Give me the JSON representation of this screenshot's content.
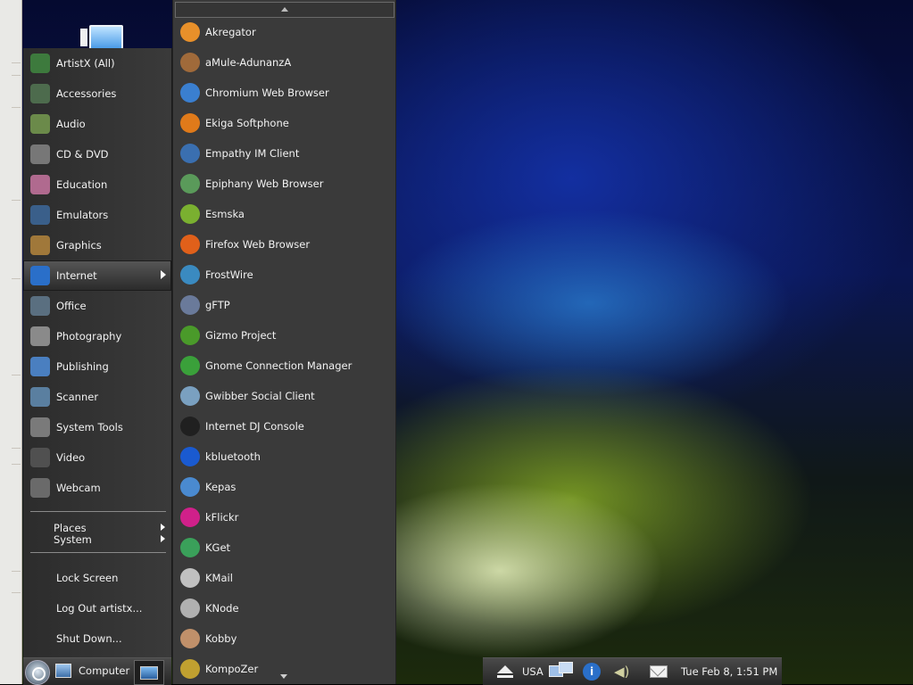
{
  "categories": [
    {
      "label": "ArtistX (All)",
      "icon": "artistx-icon",
      "color": "#3d7a3d"
    },
    {
      "label": "Accessories",
      "icon": "accessories-icon",
      "color": "#4d6b4d"
    },
    {
      "label": "Audio",
      "icon": "audio-icon",
      "color": "#6b8a4a"
    },
    {
      "label": "CD & DVD",
      "icon": "cd-dvd-icon",
      "color": "#777777"
    },
    {
      "label": "Education",
      "icon": "education-icon",
      "color": "#b06a8f"
    },
    {
      "label": "Emulators",
      "icon": "emulators-icon",
      "color": "#3a5f8a"
    },
    {
      "label": "Graphics",
      "icon": "graphics-icon",
      "color": "#a0783a"
    },
    {
      "label": "Internet",
      "icon": "internet-icon",
      "color": "#2a6fc9"
    },
    {
      "label": "Office",
      "icon": "office-icon",
      "color": "#5a6f80"
    },
    {
      "label": "Photography",
      "icon": "photography-icon",
      "color": "#8a8a8a"
    },
    {
      "label": "Publishing",
      "icon": "publishing-icon",
      "color": "#4a7fc0"
    },
    {
      "label": "Scanner",
      "icon": "scanner-icon",
      "color": "#5a7fa0"
    },
    {
      "label": "System Tools",
      "icon": "system-tools-icon",
      "color": "#7a7a7a"
    },
    {
      "label": "Video",
      "icon": "video-icon",
      "color": "#505050"
    },
    {
      "label": "Webcam",
      "icon": "webcam-icon",
      "color": "#6a6a6a"
    }
  ],
  "active_category": "Internet",
  "places_label": "Places",
  "system_label": "System",
  "lock_screen_label": "Lock Screen",
  "log_out_label": "Log Out artistx...",
  "shut_down_label": "Shut Down...",
  "apps": [
    {
      "label": "Akregator",
      "icon": "akregator-icon",
      "color": "#e8902a"
    },
    {
      "label": "aMule-AdunanzA",
      "icon": "amule-icon",
      "color": "#a06a3a"
    },
    {
      "label": "Chromium Web Browser",
      "icon": "chromium-icon",
      "color": "#3a7fd0"
    },
    {
      "label": "Ekiga Softphone",
      "icon": "ekiga-icon",
      "color": "#e07a1a"
    },
    {
      "label": "Empathy IM Client",
      "icon": "empathy-icon",
      "color": "#3a6fb0"
    },
    {
      "label": "Epiphany Web Browser",
      "icon": "epiphany-icon",
      "color": "#5a9a5a"
    },
    {
      "label": "Esmska",
      "icon": "esmska-icon",
      "color": "#7ab030"
    },
    {
      "label": "Firefox Web Browser",
      "icon": "firefox-icon",
      "color": "#e0601a"
    },
    {
      "label": "FrostWire",
      "icon": "frostwire-icon",
      "color": "#3a8ac0"
    },
    {
      "label": "gFTP",
      "icon": "gftp-icon",
      "color": "#6a7a9a"
    },
    {
      "label": "Gizmo Project",
      "icon": "gizmo-icon",
      "color": "#4a9a2a"
    },
    {
      "label": "Gnome Connection Manager",
      "icon": "gnome-connection-icon",
      "color": "#3aa03a"
    },
    {
      "label": "Gwibber Social Client",
      "icon": "gwibber-icon",
      "color": "#7aa0c0"
    },
    {
      "label": "Internet DJ Console",
      "icon": "dj-console-icon",
      "color": "#202020"
    },
    {
      "label": "kbluetooth",
      "icon": "bluetooth-icon",
      "color": "#1a5ad0"
    },
    {
      "label": "Kepas",
      "icon": "kepas-icon",
      "color": "#4a8ad0"
    },
    {
      "label": "kFlickr",
      "icon": "kflickr-icon",
      "color": "#d0208a"
    },
    {
      "label": "KGet",
      "icon": "kget-icon",
      "color": "#3aa05a"
    },
    {
      "label": "KMail",
      "icon": "kmail-icon",
      "color": "#c0c0c0"
    },
    {
      "label": "KNode",
      "icon": "knode-icon",
      "color": "#b0b0b0"
    },
    {
      "label": "Kobby",
      "icon": "kobby-icon",
      "color": "#c0906a"
    },
    {
      "label": "KompoZer",
      "icon": "kompozer-icon",
      "color": "#c0a030"
    }
  ],
  "panel": {
    "computer_label": "Computer",
    "keyboard_layout": "USA",
    "clock": "Tue Feb  8,  1:51 PM"
  }
}
